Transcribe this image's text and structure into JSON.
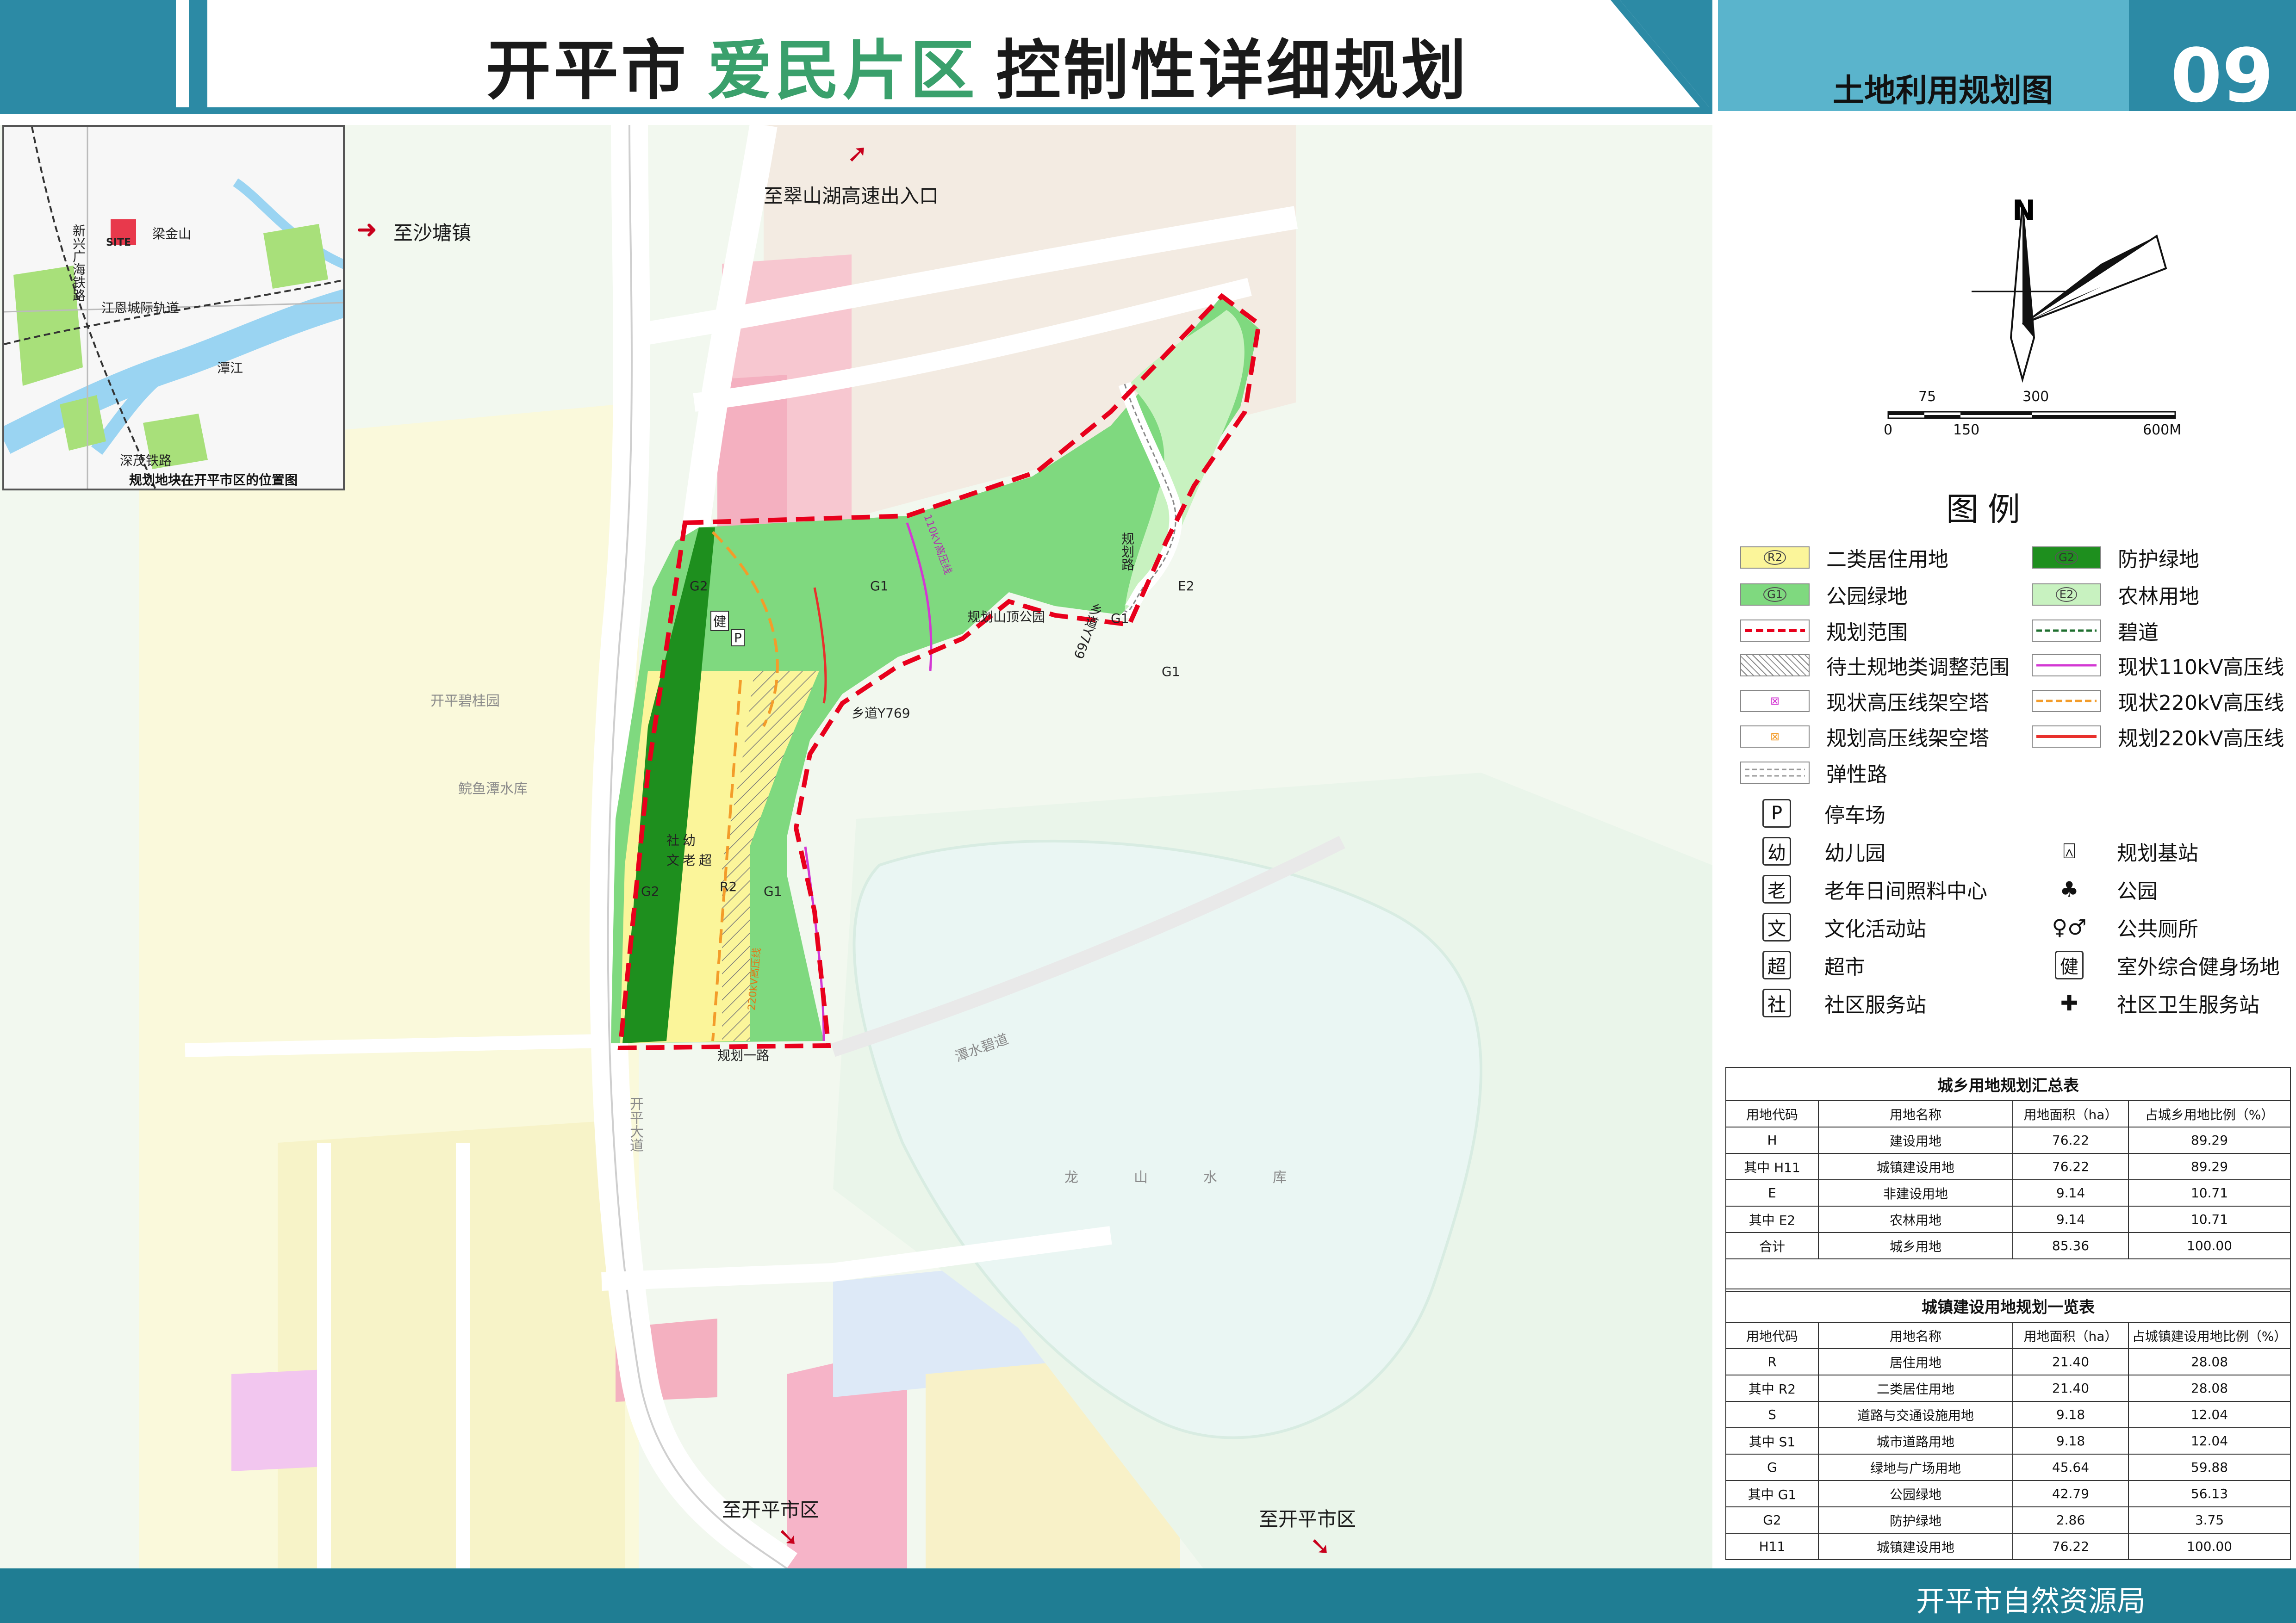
{
  "header": {
    "city": "开平市",
    "district": "爱民片区",
    "plan_title": "控制性详细规划",
    "sheet_name": "土地利用规划图",
    "sheet_number": "09"
  },
  "footer": {
    "organization": "开平市自然资源局"
  },
  "inset": {
    "caption": "规划地块在开平市区的位置图",
    "labels": {
      "site": "SITE",
      "liangjinshan": "梁金山",
      "xinxing": "新兴广海铁路",
      "jiangen": "江恩城际轨道",
      "tanjiang": "潭江",
      "shenmao": "深茂铁路"
    }
  },
  "map": {
    "directions": {
      "to_shatang": "至沙塘镇",
      "to_cuishan": "至翠山湖高速出入口",
      "to_kaiping_1": "至开平市区",
      "to_kaiping_2": "至开平市区"
    },
    "labels": {
      "park": "规划山顶公园",
      "g1_a": "G1",
      "g1_b": "G1",
      "g1_c": "G1",
      "g1_d": "G1",
      "g2_a": "G2",
      "g2_b": "G2",
      "r2": "R2",
      "e2": "E2",
      "road_plan": "规划路",
      "road_plan_one": "规划一路",
      "road_y769": "乡道Y769",
      "road_y769_v": "乡道Y769",
      "line_110": "110kV高压线",
      "line_220": "220kV高压线",
      "kaiping_blvd": "开平大道",
      "biguiyuan": "开平碧桂园",
      "reservoir": "鲩鱼潭水库",
      "longshan": "龙山水库",
      "bidao": "潭水碧道",
      "fac_she": "社",
      "fac_you": "幼",
      "fac_wen": "文",
      "fac_lao": "老",
      "fac_chao": "超",
      "fac_jian": "健",
      "fac_p": "P"
    }
  },
  "north": {
    "label": "N"
  },
  "scale": {
    "labels": [
      "75",
      "300",
      "0",
      "150",
      "600M"
    ]
  },
  "legend": {
    "title": "图例",
    "items": [
      {
        "symbol": "R2",
        "label": "二类居住用地",
        "color": "#fbf59a"
      },
      {
        "symbol": "G2",
        "label": "防护绿地",
        "color": "#1e8f1e"
      },
      {
        "symbol": "G1",
        "label": "公园绿地",
        "color": "#7fd97f"
      },
      {
        "symbol": "E2",
        "label": "农林用地",
        "color": "#c8f2c0"
      },
      {
        "symbol": "",
        "label": "规划范围",
        "color": "#e8001c"
      },
      {
        "symbol": "",
        "label": "碧道",
        "color": "#1f6f2f"
      },
      {
        "symbol": "",
        "label": "待土规地类调整范围",
        "color": "#888888"
      },
      {
        "symbol": "",
        "label": "现状110kV高压线",
        "color": "#d338d3"
      },
      {
        "symbol": "⊠",
        "label": "现状高压线架空塔",
        "color": "#d338d3"
      },
      {
        "symbol": "",
        "label": "现状220kV高压线",
        "color": "#f39c2a"
      },
      {
        "symbol": "⊠",
        "label": "规划高压线架空塔",
        "color": "#f39c2a"
      },
      {
        "symbol": "",
        "label": "规划220kV高压线",
        "color": "#e8302c"
      },
      {
        "symbol": "",
        "label": "弹性路",
        "color": "#999999"
      }
    ],
    "facilities": [
      {
        "symbol": "P",
        "label": "停车场"
      },
      {
        "symbol": "幼",
        "label": "幼儿园"
      },
      {
        "symbol": "老",
        "label": "老年日间照料中心"
      },
      {
        "symbol": "文",
        "label": "文化活动站"
      },
      {
        "symbol": "超",
        "label": "超市"
      },
      {
        "symbol": "社",
        "label": "社区服务站"
      },
      {
        "symbol": "⍓",
        "label": "规划基站"
      },
      {
        "symbol": "♣",
        "label": "公园"
      },
      {
        "symbol": "♀♂",
        "label": "公共厕所"
      },
      {
        "symbol": "健",
        "label": "室外综合健身场地"
      },
      {
        "symbol": "✚",
        "label": "社区卫生服务站"
      }
    ]
  },
  "table1": {
    "title": "城乡用地规划汇总表",
    "headers": [
      "用地代码",
      "用地名称",
      "用地面积（ha）",
      "占城乡用地比例（%）"
    ],
    "rows": [
      {
        "prefix": "",
        "code": "H",
        "name": "建设用地",
        "area": "76.22",
        "ratio": "89.29"
      },
      {
        "prefix": "其中",
        "code": "H11",
        "name": "城镇建设用地",
        "area": "76.22",
        "ratio": "89.29"
      },
      {
        "prefix": "",
        "code": "E",
        "name": "非建设用地",
        "area": "9.14",
        "ratio": "10.71"
      },
      {
        "prefix": "其中",
        "code": "E2",
        "name": "农林用地",
        "area": "9.14",
        "ratio": "10.71"
      },
      {
        "prefix": "",
        "code": "合计",
        "name": "城乡用地",
        "area": "85.36",
        "ratio": "100.00"
      }
    ]
  },
  "table2": {
    "title": "城镇建设用地规划一览表",
    "headers": [
      "用地代码",
      "用地名称",
      "用地面积（ha）",
      "占城镇建设用地比例（%）"
    ],
    "rows": [
      {
        "prefix": "",
        "code": "R",
        "name": "居住用地",
        "area": "21.40",
        "ratio": "28.08"
      },
      {
        "prefix": "其中",
        "code": "R2",
        "name": "二类居住用地",
        "area": "21.40",
        "ratio": "28.08"
      },
      {
        "prefix": "",
        "code": "S",
        "name": "道路与交通设施用地",
        "area": "9.18",
        "ratio": "12.04"
      },
      {
        "prefix": "其中",
        "code": "S1",
        "name": "城市道路用地",
        "area": "9.18",
        "ratio": "12.04"
      },
      {
        "prefix": "",
        "code": "G",
        "name": "绿地与广场用地",
        "area": "45.64",
        "ratio": "59.88"
      },
      {
        "prefix": "其中",
        "code": "G1",
        "name": "公园绿地",
        "area": "42.79",
        "ratio": "56.13"
      },
      {
        "prefix": "",
        "code": "G2",
        "name": "防护绿地",
        "area": "2.86",
        "ratio": "3.75"
      },
      {
        "prefix": "",
        "code": "H11",
        "name": "城镇建设用地",
        "area": "76.22",
        "ratio": "100.00"
      }
    ]
  }
}
